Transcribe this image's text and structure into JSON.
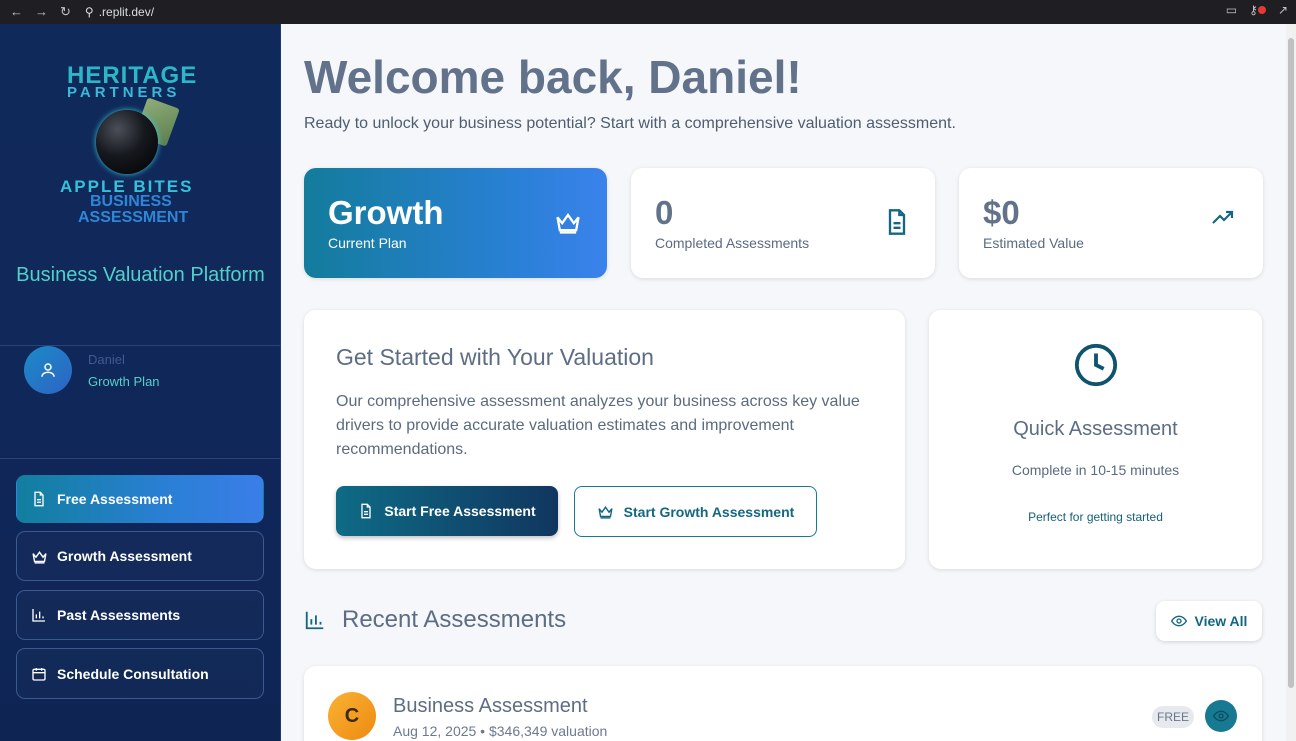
{
  "browser": {
    "url": ".replit.dev/"
  },
  "sidebar": {
    "logo": {
      "line1": "HERITAGE",
      "line2": "PARTNERS",
      "line3": "APPLE BITES",
      "line4": "BUSINESS",
      "line5": "ASSESSMENT"
    },
    "platform_title": "Business Valuation Platform",
    "user": {
      "name": "Daniel",
      "plan": "Growth Plan"
    },
    "nav": [
      {
        "label": "Free Assessment",
        "icon": "document-icon",
        "active": true
      },
      {
        "label": "Growth Assessment",
        "icon": "crown-icon",
        "active": false
      },
      {
        "label": "Past Assessments",
        "icon": "bar-chart-icon",
        "active": false
      },
      {
        "label": "Schedule Consultation",
        "icon": "calendar-icon",
        "active": false
      }
    ]
  },
  "main": {
    "welcome": "Welcome back, Daniel!",
    "subtitle": "Ready to unlock your business potential? Start with a comprehensive valuation assessment.",
    "stats": {
      "plan": {
        "value": "Growth",
        "label": "Current Plan"
      },
      "completed": {
        "value": "0",
        "label": "Completed Assessments"
      },
      "estimated": {
        "value": "$0",
        "label": "Estimated Value"
      }
    },
    "start": {
      "title": "Get Started with Your Valuation",
      "body": "Our comprehensive assessment analyzes your business across key value drivers to provide accurate valuation estimates and improvement recommendations.",
      "primary_label": "Start Free Assessment",
      "secondary_label": "Start Growth Assessment"
    },
    "quick": {
      "title": "Quick Assessment",
      "duration": "Complete in 10-15 minutes",
      "note": "Perfect for getting started"
    },
    "recent": {
      "title": "Recent Assessments",
      "view_all": "View All",
      "rows": [
        {
          "initial": "C",
          "title": "Business Assessment",
          "subtitle": "Aug 12, 2025 • $346,349 valuation",
          "badge": "FREE"
        }
      ]
    }
  },
  "colors": {
    "sidebar_bg": "#0f2a5a",
    "accent_teal": "#177a92",
    "accent_blue": "#2a80d6",
    "text_muted": "#5b6b80"
  }
}
